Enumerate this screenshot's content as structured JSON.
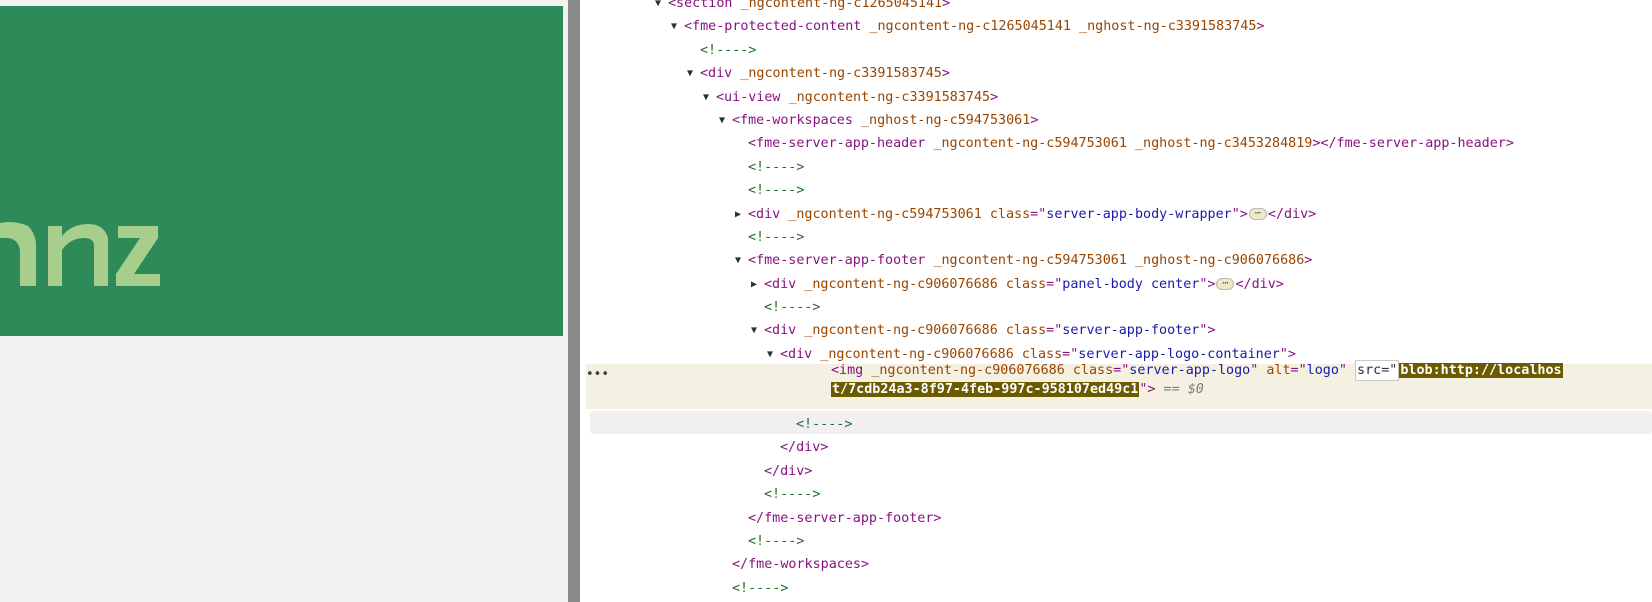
{
  "page_preview": {
    "banner_color": "#2f8a5a",
    "logo_fragment_text": "nz",
    "logo_text_color": "#a7cf8b"
  },
  "dom_tree": [
    {
      "depth": 0,
      "toggle": "open",
      "parts": [
        [
          "tag",
          "<section "
        ],
        [
          "an",
          "_ngcontent-ng-c1265045141"
        ],
        [
          "tag",
          ">"
        ]
      ]
    },
    {
      "depth": 1,
      "toggle": "open",
      "parts": [
        [
          "tag",
          "<fme-protected-content "
        ],
        [
          "an",
          "_ngcontent-ng-c1265045141 _nghost-ng-c3391583745"
        ],
        [
          "tag",
          ">"
        ]
      ]
    },
    {
      "depth": 2,
      "toggle": "none",
      "parts": [
        [
          "cm",
          "<!---->"
        ]
      ]
    },
    {
      "depth": 2,
      "toggle": "open",
      "parts": [
        [
          "tag",
          "<div "
        ],
        [
          "an",
          "_ngcontent-ng-c3391583745"
        ],
        [
          "tag",
          ">"
        ]
      ]
    },
    {
      "depth": 3,
      "toggle": "open",
      "parts": [
        [
          "tag",
          "<ui-view "
        ],
        [
          "an",
          "_ngcontent-ng-c3391583745"
        ],
        [
          "tag",
          ">"
        ]
      ]
    },
    {
      "depth": 4,
      "toggle": "open",
      "parts": [
        [
          "tag",
          "<fme-workspaces "
        ],
        [
          "an",
          "_nghost-ng-c594753061"
        ],
        [
          "tag",
          ">"
        ]
      ]
    },
    {
      "depth": 5,
      "toggle": "none",
      "parts": [
        [
          "tag",
          "<fme-server-app-header "
        ],
        [
          "an",
          "_ngcontent-ng-c594753061 _nghost-ng-c3453284819"
        ],
        [
          "tag",
          "></fme-server-app-header>"
        ]
      ]
    },
    {
      "depth": 5,
      "toggle": "none",
      "parts": [
        [
          "cm",
          "<!---->"
        ]
      ]
    },
    {
      "depth": 5,
      "toggle": "none",
      "parts": [
        [
          "cm",
          "<!---->"
        ]
      ]
    },
    {
      "depth": 5,
      "toggle": "closed",
      "parts": [
        [
          "tag",
          "<div "
        ],
        [
          "an",
          "_ngcontent-ng-c594753061 class"
        ],
        [
          "tag",
          "=\""
        ],
        [
          "av",
          "server-app-body-wrapper"
        ],
        [
          "tag",
          "\">"
        ],
        [
          "ell",
          "⋯"
        ],
        [
          "tag",
          "</div>"
        ]
      ]
    },
    {
      "depth": 5,
      "toggle": "none",
      "parts": [
        [
          "cm",
          "<!---->"
        ]
      ]
    },
    {
      "depth": 5,
      "toggle": "open",
      "parts": [
        [
          "tag",
          "<fme-server-app-footer "
        ],
        [
          "an",
          "_ngcontent-ng-c594753061 _nghost-ng-c906076686"
        ],
        [
          "tag",
          ">"
        ]
      ]
    },
    {
      "depth": 6,
      "toggle": "closed",
      "parts": [
        [
          "tag",
          "<div "
        ],
        [
          "an",
          "_ngcontent-ng-c906076686 class"
        ],
        [
          "tag",
          "=\""
        ],
        [
          "av",
          "panel-body center"
        ],
        [
          "tag",
          "\">"
        ],
        [
          "ell",
          "⋯"
        ],
        [
          "tag",
          "</div>"
        ]
      ]
    },
    {
      "depth": 6,
      "toggle": "none",
      "parts": [
        [
          "cm",
          "<!---->"
        ]
      ]
    },
    {
      "depth": 6,
      "toggle": "open",
      "parts": [
        [
          "tag",
          "<div "
        ],
        [
          "an",
          "_ngcontent-ng-c906076686 class"
        ],
        [
          "tag",
          "=\""
        ],
        [
          "av",
          "server-app-footer"
        ],
        [
          "tag",
          "\">"
        ]
      ]
    },
    {
      "depth": 7,
      "toggle": "open",
      "parts": [
        [
          "tag",
          "<div "
        ],
        [
          "an",
          "_ngcontent-ng-c906076686 class"
        ],
        [
          "tag",
          "=\""
        ],
        [
          "av",
          "server-app-logo-container"
        ],
        [
          "tag",
          "\">"
        ]
      ]
    },
    {
      "depth": 8,
      "toggle": "none",
      "parts": []
    },
    {
      "depth": 8,
      "toggle": "none",
      "parts": []
    },
    {
      "depth": 8,
      "toggle": "none",
      "parts": [
        [
          "cm",
          "<!---->"
        ]
      ]
    },
    {
      "depth": 7,
      "toggle": "none",
      "parts": [
        [
          "tag",
          "</div>"
        ]
      ]
    },
    {
      "depth": 6,
      "toggle": "none",
      "parts": [
        [
          "tag",
          "</div>"
        ]
      ]
    },
    {
      "depth": 6,
      "toggle": "none",
      "parts": [
        [
          "cm",
          "<!---->"
        ]
      ]
    },
    {
      "depth": 5,
      "toggle": "none",
      "parts": [
        [
          "tag",
          "</fme-server-app-footer>"
        ]
      ]
    },
    {
      "depth": 5,
      "toggle": "none",
      "parts": [
        [
          "cm",
          "<!---->"
        ]
      ]
    },
    {
      "depth": 4,
      "toggle": "none",
      "parts": [
        [
          "tag",
          "</fme-workspaces>"
        ]
      ]
    },
    {
      "depth": 4,
      "toggle": "none",
      "parts": [
        [
          "cm",
          "<!---->"
        ]
      ]
    }
  ],
  "selected_node": {
    "dots": "•••",
    "open_tag": "<img ",
    "attrs": "_ngcontent-ng-c906076686 class",
    "eq1": "=\"",
    "class_value": "server-app-logo",
    "q1": "\" ",
    "alt_name": "alt",
    "eq2": "=\"",
    "alt_value": "logo",
    "q2": "\" ",
    "src_editing_label": "src=\"",
    "src_value_line1": "blob:http://localhos",
    "src_value_line2": "t/7cdb24a3-8f97-4feb-997c-958107ed49c1",
    "close_quote": "\"",
    "close_tag": ">",
    "console_ref": " == $0"
  }
}
